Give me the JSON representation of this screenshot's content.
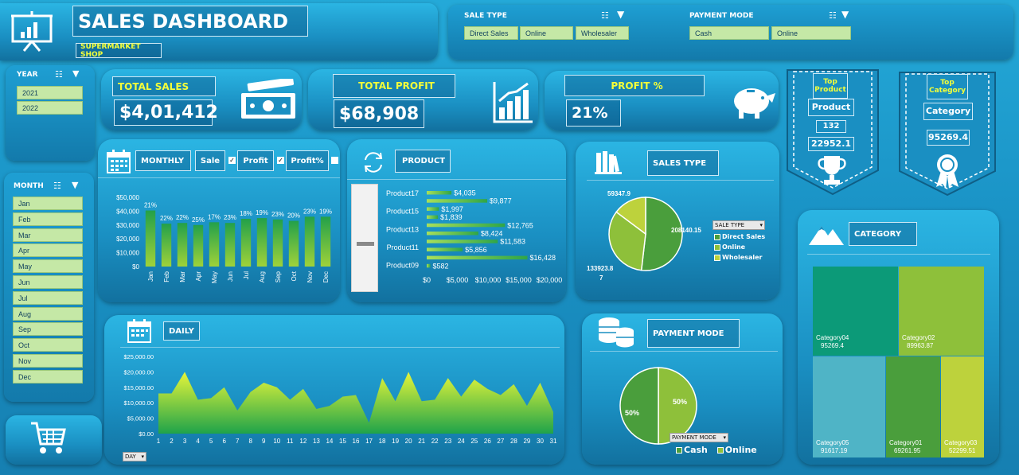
{
  "header": {
    "title": "SALES DASHBOARD",
    "subtitle": "SUPERMARKET SHOP"
  },
  "filters": {
    "sale_type": {
      "title": "SALE TYPE",
      "items": [
        "Direct Sales",
        "Online",
        "Wholesaler"
      ]
    },
    "payment_mode": {
      "title": "PAYMENT MODE",
      "items": [
        "Cash",
        "Online"
      ]
    },
    "year": {
      "title": "YEAR",
      "items": [
        "2021",
        "2022"
      ]
    },
    "month": {
      "title": "MONTH",
      "items": [
        "Jan",
        "Feb",
        "Mar",
        "Apr",
        "May",
        "Jun",
        "Jul",
        "Aug",
        "Sep",
        "Oct",
        "Nov",
        "Dec"
      ]
    }
  },
  "kpis": {
    "total_sales": {
      "label": "TOTAL SALES",
      "value": "$4,01,412"
    },
    "total_profit": {
      "label": "TOTAL PROFIT",
      "value": "$68,908"
    },
    "profit_pct": {
      "label": "PROFIT %",
      "value": "21%"
    }
  },
  "top_product": {
    "heading": "Top Product",
    "name": "Product",
    "id": "132",
    "value": "22952.1"
  },
  "top_category": {
    "heading": "Top Category",
    "name": "Category",
    "value": "95269.4"
  },
  "monthly": {
    "title": "MONTHLY",
    "toggles": {
      "sale": "Sale",
      "profit": "Profit",
      "profit_pct": "Profit%"
    }
  },
  "product": {
    "title": "PRODUCT"
  },
  "sales_type": {
    "title": "SALES TYPE",
    "filter_label": "SALE TYPE",
    "legend": [
      "Direct Sales",
      "Online",
      "Wholesaler"
    ]
  },
  "category": {
    "title": "CATEGORY"
  },
  "daily": {
    "title": "DAILY",
    "filter_label": "DAY"
  },
  "payment_mode": {
    "title": "PAYMENT MODE",
    "filter_label": "PAYMENT MODE",
    "legend": [
      "Cash",
      "Online"
    ]
  },
  "colors": {
    "accent_yellow": "#f3ff3a",
    "green_dark": "#2e9a4a",
    "green_mid": "#6fb93a",
    "green_light": "#b8d93a",
    "teal": "#0c9a78",
    "slicer_bg": "#c5e8a6"
  },
  "chart_data": [
    {
      "type": "bar",
      "id": "monthly",
      "categories": [
        "Jan",
        "Feb",
        "Mar",
        "Apr",
        "May",
        "Jun",
        "Jul",
        "Aug",
        "Sep",
        "Oct",
        "Nov",
        "Dec"
      ],
      "values": [
        40500,
        31000,
        31500,
        30000,
        32000,
        31500,
        34500,
        35000,
        34000,
        33000,
        36000,
        36000
      ],
      "data_labels": [
        "21%",
        "22%",
        "22%",
        "25%",
        "17%",
        "23%",
        "18%",
        "19%",
        "23%",
        "20%",
        "23%",
        "19%"
      ],
      "yticks": [
        "$0",
        "$10,000",
        "$20,000",
        "$30,000",
        "$40,000",
        "$50,000"
      ],
      "ylim": [
        0,
        50000
      ]
    },
    {
      "type": "bar",
      "id": "product",
      "orientation": "horizontal",
      "categories": [
        "Product17",
        "",
        "Product15",
        "",
        "Product13",
        "",
        "Product11",
        "",
        "Product09"
      ],
      "values": [
        4035,
        9877,
        1997,
        1839,
        12765,
        8424,
        11583,
        5856,
        16428,
        582
      ],
      "data_labels": [
        "$4,035",
        "$9,877",
        "$1,997",
        "$1,839",
        "$12,765",
        "$8,424",
        "$11,583",
        "$5,856",
        "$16,428",
        "$582"
      ],
      "xticks": [
        "$0",
        "$5,000",
        "$10,000",
        "$15,000",
        "$20,000"
      ],
      "xlim": [
        0,
        20000
      ]
    },
    {
      "type": "pie",
      "id": "sales_type",
      "labels": [
        "Direct Sales",
        "Online",
        "Wholesaler"
      ],
      "values": [
        208140.15,
        133923.87,
        59347.9
      ],
      "data_labels": [
        "208140.15",
        "133923.8\n7",
        "59347.9"
      ]
    },
    {
      "type": "area",
      "id": "daily",
      "x": [
        1,
        2,
        3,
        4,
        5,
        6,
        7,
        8,
        9,
        10,
        11,
        12,
        13,
        14,
        15,
        16,
        17,
        18,
        19,
        20,
        21,
        22,
        23,
        24,
        25,
        26,
        27,
        28,
        29,
        30,
        31
      ],
      "values": [
        13000,
        13000,
        20000,
        11000,
        11500,
        15000,
        7500,
        13500,
        16500,
        15000,
        11000,
        14500,
        8000,
        9000,
        12000,
        12500,
        3500,
        18000,
        10500,
        20000,
        10500,
        11000,
        18000,
        12000,
        17500,
        14500,
        12500,
        16000,
        9000,
        16500,
        7000
      ],
      "yticks": [
        "$0.00",
        "$5,000.00",
        "$10,000.00",
        "$15,000.00",
        "$20,000.00",
        "$25,000.00"
      ],
      "ylim": [
        0,
        25000
      ]
    },
    {
      "type": "pie",
      "id": "payment_mode",
      "labels": [
        "Cash",
        "Online"
      ],
      "values": [
        50,
        50
      ],
      "data_labels": [
        "50%",
        "50%"
      ]
    },
    {
      "type": "heatmap",
      "id": "category",
      "subtype": "treemap",
      "labels": [
        "Category04",
        "Category02",
        "Category05",
        "Category01",
        "Category03"
      ],
      "values": [
        95269.4,
        89963.87,
        91617.19,
        69261.95,
        52299.51
      ],
      "display_values": [
        "95269.4",
        "89963.87",
        "91617.19",
        "69261.95",
        "52299.51"
      ],
      "colors": [
        "#0c9a78",
        "#8ec03a",
        "#4fb4c6",
        "#4a9e3c",
        "#bdd23c"
      ]
    }
  ]
}
